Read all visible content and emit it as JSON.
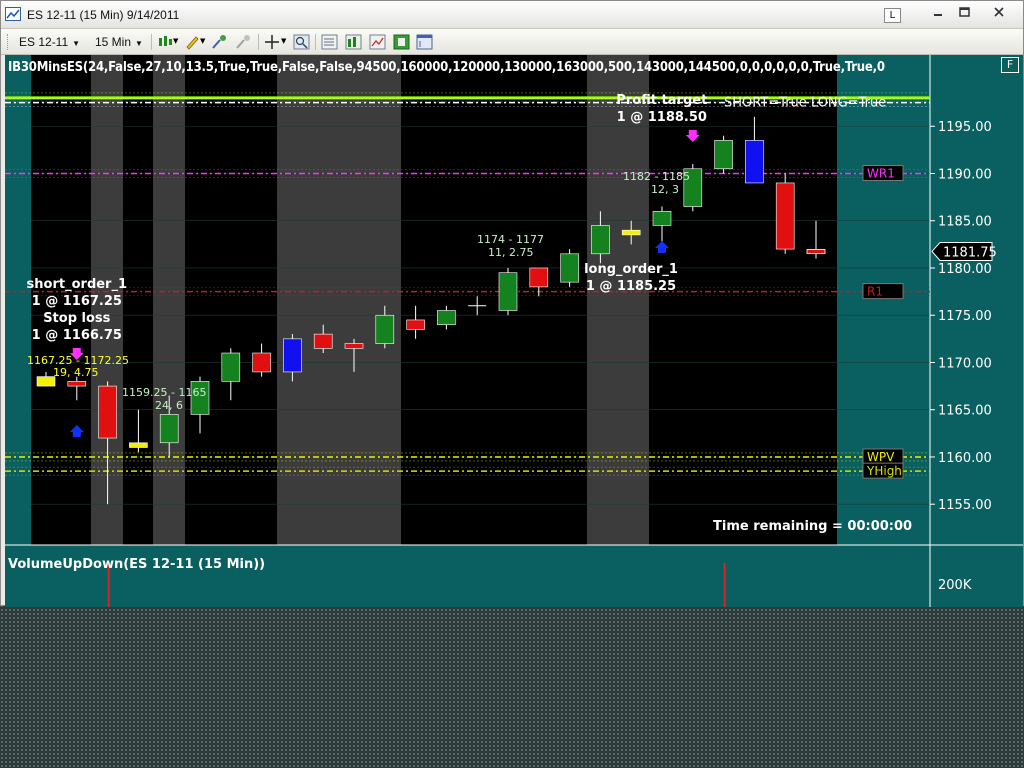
{
  "window": {
    "title": "ES 12-11 (15 Min)  9/14/2011",
    "link_button": "L",
    "minimize_icon": "minimize-icon",
    "maximize_icon": "maximize-icon",
    "close_icon": "close-icon"
  },
  "toolbar": {
    "instrument": "ES 12-11",
    "interval": "15 Min"
  },
  "chart": {
    "indicator_label": "IB30MinsES(24,False,27,10,13.5,True,True,False,False,94500,160000,120000,130000,163000,500,143000,144500,0,0,0,0,0,0,True,True,0",
    "float_button": "F",
    "volume_label": "VolumeUpDown(ES 12-11 (15 Min))",
    "volume_tick": "200K",
    "current_price": "1181.75",
    "time_remaining": "Time remaining = 00:00:00",
    "short_long_text": "SHORT=True LONG=True",
    "colors": {
      "background": "#000000",
      "session_shade": "#3c3c3c",
      "margin": "#0a6060",
      "up": "#14821e",
      "down": "#e01010",
      "neutral": "#1010f0",
      "doji_yellow": "#f4f000"
    }
  },
  "chart_data": {
    "type": "candlestick",
    "title": "",
    "ylim": [
      1151,
      1200
    ],
    "y_ticks": [
      "1195.00",
      "1190.00",
      "1185.00",
      "1180.00",
      "1175.00",
      "1170.00",
      "1165.00",
      "1160.00",
      "1155.00"
    ],
    "candles": [
      {
        "o": 1168.5,
        "h": 1169.0,
        "l": 1167.5,
        "c": 1167.5,
        "color": "yellow"
      },
      {
        "o": 1168.0,
        "h": 1168.5,
        "l": 1166.0,
        "c": 1167.5,
        "color": "red"
      },
      {
        "o": 1167.5,
        "h": 1168.0,
        "l": 1155.0,
        "c": 1162.0,
        "color": "red"
      },
      {
        "o": 1161.5,
        "h": 1165.0,
        "l": 1160.5,
        "c": 1161.0,
        "color": "yellow"
      },
      {
        "o": 1161.5,
        "h": 1166.5,
        "l": 1160.0,
        "c": 1164.5,
        "color": "green"
      },
      {
        "o": 1164.5,
        "h": 1168.5,
        "l": 1162.5,
        "c": 1168.0,
        "color": "green"
      },
      {
        "o": 1168.0,
        "h": 1171.5,
        "l": 1166.0,
        "c": 1171.0,
        "color": "green"
      },
      {
        "o": 1171.0,
        "h": 1172.0,
        "l": 1168.5,
        "c": 1169.0,
        "color": "red"
      },
      {
        "o": 1172.5,
        "h": 1173.0,
        "l": 1168.0,
        "c": 1169.0,
        "color": "blue"
      },
      {
        "o": 1173.0,
        "h": 1174.0,
        "l": 1171.0,
        "c": 1171.5,
        "color": "red"
      },
      {
        "o": 1171.5,
        "h": 1172.5,
        "l": 1169.0,
        "c": 1172.0,
        "color": "red"
      },
      {
        "o": 1172.0,
        "h": 1176.0,
        "l": 1171.5,
        "c": 1175.0,
        "color": "green"
      },
      {
        "o": 1174.5,
        "h": 1176.0,
        "l": 1172.5,
        "c": 1173.5,
        "color": "red"
      },
      {
        "o": 1174.0,
        "h": 1176.0,
        "l": 1173.5,
        "c": 1175.5,
        "color": "green"
      },
      {
        "o": 1176.0,
        "h": 1177.0,
        "l": 1175.0,
        "c": 1176.0,
        "color": "cross"
      },
      {
        "o": 1175.5,
        "h": 1180.0,
        "l": 1175.0,
        "c": 1179.5,
        "color": "green"
      },
      {
        "o": 1178.0,
        "h": 1180.0,
        "l": 1177.0,
        "c": 1180.0,
        "color": "red"
      },
      {
        "o": 1178.5,
        "h": 1182.0,
        "l": 1178.0,
        "c": 1181.5,
        "color": "green"
      },
      {
        "o": 1181.5,
        "h": 1186.0,
        "l": 1180.5,
        "c": 1184.5,
        "color": "green"
      },
      {
        "o": 1184.0,
        "h": 1185.0,
        "l": 1182.5,
        "c": 1183.5,
        "color": "yellow"
      },
      {
        "o": 1184.5,
        "h": 1186.5,
        "l": 1182.5,
        "c": 1186.0,
        "color": "green"
      },
      {
        "o": 1186.5,
        "h": 1191.0,
        "l": 1186.0,
        "c": 1190.5,
        "color": "green"
      },
      {
        "o": 1190.5,
        "h": 1194.0,
        "l": 1190.0,
        "c": 1193.5,
        "color": "green"
      },
      {
        "o": 1193.5,
        "h": 1196.0,
        "l": 1189.0,
        "c": 1189.0,
        "color": "blue"
      },
      {
        "o": 1189.0,
        "h": 1190.0,
        "l": 1181.5,
        "c": 1182.0,
        "color": "red"
      },
      {
        "o": 1182.0,
        "h": 1185.0,
        "l": 1181.0,
        "c": 1181.75,
        "color": "red-dash"
      }
    ],
    "levels": [
      {
        "name": "",
        "price": 1198.0,
        "color": "#9aff00"
      },
      {
        "name": "SHORT=True LONG=True",
        "price": 1197.5,
        "color": "#ffffff"
      },
      {
        "name": "WR1",
        "price": 1190.0,
        "color": "#ff30ff"
      },
      {
        "name": "R1",
        "price": 1177.5,
        "color": "#c02020"
      },
      {
        "name": "WPV",
        "price": 1160.0,
        "color": "#f0f000"
      },
      {
        "name": "YHigh",
        "price": 1158.5,
        "color": "#d8e000"
      }
    ],
    "annotations": [
      {
        "text": "short_order_1",
        "candle": 1,
        "price": 1168.5
      },
      {
        "text": "1 @ 1167.25",
        "candle": 1,
        "price": 1168.5
      },
      {
        "text": "Stop loss",
        "candle": 1,
        "price": 1168.5
      },
      {
        "text": "1 @ 1166.75",
        "candle": 1,
        "price": 1168.5
      },
      {
        "text": "Profit target",
        "candle": 21,
        "price": 1190.5
      },
      {
        "text": "1 @ 1188.50",
        "candle": 21,
        "price": 1190.5
      },
      {
        "text": "long_order_1",
        "candle": 20,
        "price": 1182.0
      },
      {
        "text": "1 @ 1185.25",
        "candle": 20,
        "price": 1182.0
      }
    ],
    "range_labels": [
      {
        "text": "1167.25 - 1172.25",
        "candle": 0,
        "price": 1170.0
      },
      {
        "text": "19, 4.75",
        "candle": 0,
        "price": 1168.5
      },
      {
        "text": "1159.25 - 1165",
        "candle": 4,
        "price": 1166.5
      },
      {
        "text": "24, 6",
        "candle": 4,
        "price": 1165.0
      },
      {
        "text": "1174 - 1177",
        "candle": 15,
        "price": 1182.0
      },
      {
        "text": "11, 2.75",
        "candle": 15,
        "price": 1180.5
      },
      {
        "text": "1182 - 1185",
        "candle": 20,
        "price": 1188.5
      },
      {
        "text": "12, 3",
        "candle": 20,
        "price": 1187.0
      }
    ],
    "volume_spikes": [
      {
        "candle": 2
      },
      {
        "candle": 22
      }
    ]
  }
}
